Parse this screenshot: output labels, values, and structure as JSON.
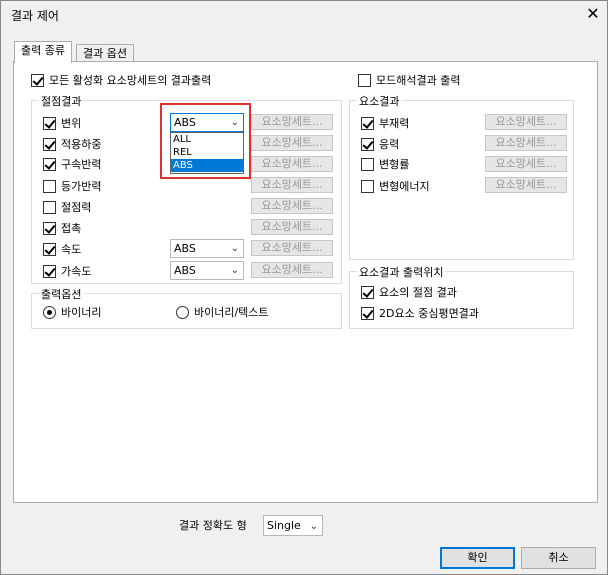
{
  "window": {
    "title": "결과 제어",
    "close_glyph": "✕"
  },
  "tabs": [
    {
      "label": "출력 종류",
      "active": true
    },
    {
      "label": "결과 옵션",
      "active": false
    }
  ],
  "top_options": {
    "all_active_output": {
      "label": "모든 활성화 요소망세트의 결과출력",
      "checked": true
    },
    "mode_shape_output": {
      "label": "모드해석결과 출력",
      "checked": false
    }
  },
  "node_results": {
    "title": "절점결과",
    "set_button_label": "요소망세트...",
    "items": [
      {
        "label": "변위",
        "checked": true,
        "combo": "ABS"
      },
      {
        "label": "적용하중",
        "checked": true,
        "combo": null
      },
      {
        "label": "구속반력",
        "checked": true,
        "combo": null
      },
      {
        "label": "등가반력",
        "checked": false,
        "combo": null
      },
      {
        "label": "절점력",
        "checked": false,
        "combo": null
      },
      {
        "label": "접촉",
        "checked": true,
        "combo": null
      },
      {
        "label": "속도",
        "checked": true,
        "combo": "ABS"
      },
      {
        "label": "가속도",
        "checked": true,
        "combo": "ABS"
      }
    ],
    "dropdown": {
      "options": [
        "ALL",
        "REL",
        "ABS"
      ],
      "selected": "ABS"
    }
  },
  "element_results": {
    "title": "요소결과",
    "set_button_label": "요소망세트...",
    "items": [
      {
        "label": "부재력",
        "checked": true
      },
      {
        "label": "응력",
        "checked": true
      },
      {
        "label": "변형률",
        "checked": false
      },
      {
        "label": "변형에너지",
        "checked": false
      }
    ]
  },
  "output_options": {
    "title": "출력옵션",
    "binary": {
      "label": "바이너리",
      "selected": true
    },
    "binary_text": {
      "label": "바이너리/텍스트",
      "selected": false
    }
  },
  "element_output_location": {
    "title": "요소결과 출력위치",
    "node_results": {
      "label": "요소의 절점 결과",
      "checked": true
    },
    "center_2d": {
      "label": "2D요소 중심평면결과",
      "checked": true
    }
  },
  "precision": {
    "label": "결과 정확도 형",
    "value": "Single"
  },
  "buttons": {
    "ok": "확인",
    "cancel": "취소"
  }
}
